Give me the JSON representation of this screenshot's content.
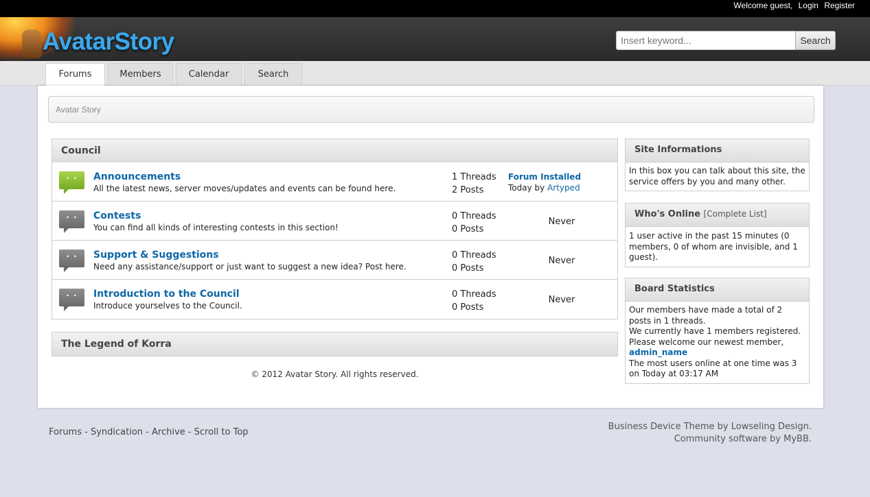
{
  "topbar": {
    "welcome": "Welcome guest,",
    "login": "Login",
    "register": "Register"
  },
  "header": {
    "logo_text": "AvatarStory",
    "search": {
      "placeholder": "Insert keyword...",
      "button": "Search"
    }
  },
  "nav": {
    "tabs": [
      {
        "label": "Forums",
        "active": true
      },
      {
        "label": "Members"
      },
      {
        "label": "Calendar"
      },
      {
        "label": "Search"
      }
    ]
  },
  "breadcrumb": "Avatar Story",
  "categories": [
    {
      "title": "Council",
      "forums": [
        {
          "title": "Announcements",
          "description": "All the latest news, server moves/updates and events can be found here.",
          "threads": "1 Threads",
          "posts": "2 Posts",
          "status": "new",
          "lastpost": {
            "title": "Forum Installed",
            "when": "Today by",
            "user": "Artyped"
          }
        },
        {
          "title": "Contests",
          "description": "You can find all kinds of interesting contests in this section!",
          "threads": "0 Threads",
          "posts": "0 Posts",
          "status": "old",
          "lastpost": "Never"
        },
        {
          "title": "Support & Suggestions",
          "description": "Need any assistance/support or just want to suggest a new idea? Post here.",
          "threads": "0 Threads",
          "posts": "0 Posts",
          "status": "old",
          "lastpost": "Never"
        },
        {
          "title": "Introduction to the Council",
          "description": "Introduce yourselves to the Council.",
          "threads": "0 Threads",
          "posts": "0 Posts",
          "status": "old",
          "lastpost": "Never"
        }
      ]
    },
    {
      "title": "The Legend of Korra",
      "forums": []
    }
  ],
  "copyright": "© 2012 Avatar Story. All rights reserved.",
  "sidebar": {
    "site_info": {
      "title": "Site Informations",
      "text": "In this box you can talk about this site, the service offers by you and many other."
    },
    "whos_online": {
      "title": "Who's Online",
      "link": "[Complete List]",
      "text": "1 user active in the past 15 minutes (0 members, 0 of whom are invisible, and 1 guest)."
    },
    "board_stats": {
      "title": "Board Statistics",
      "line1": "Our members have made a total of 2 posts in 1 threads.",
      "line2": "We currently have 1 members registered.",
      "line3": "Please welcome our newest member,",
      "newest_member": "admin_name",
      "line4": "The most users online at one time was 3 on Today at 03:17 AM"
    }
  },
  "footer": {
    "links": [
      "Forums",
      "Syndication",
      "Archive",
      "Scroll to Top"
    ],
    "separator": " - ",
    "credit1": "Business Device Theme by Lowseling Design.",
    "credit2": "Community software by MyBB."
  },
  "colors": {
    "link_blue": "#0d67a7",
    "active_bubble": "#8cc23a",
    "inactive_bubble": "#7c7c7c",
    "background": "#dde0ea"
  }
}
